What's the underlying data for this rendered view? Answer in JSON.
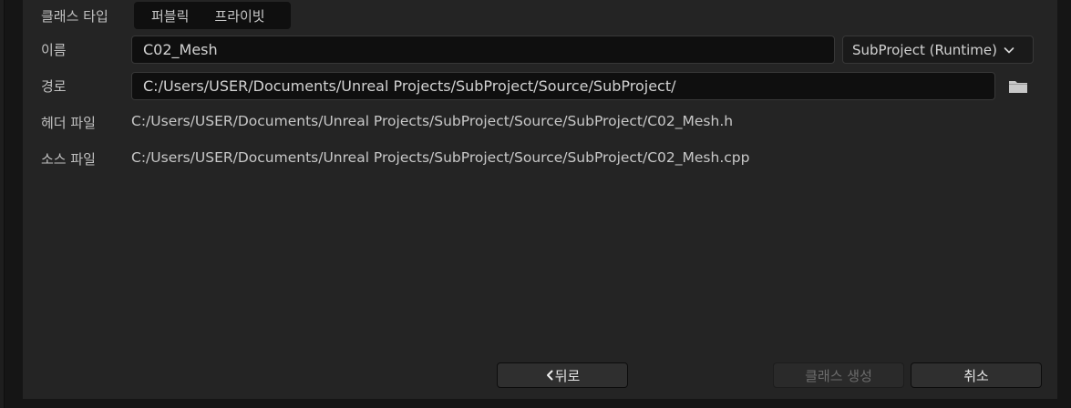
{
  "form": {
    "class_type_label": "클래스 타입",
    "class_type_options": [
      "퍼블릭",
      "프라이빗"
    ],
    "name_label": "이름",
    "name_value": "C02_Mesh",
    "module_dropdown": "SubProject (Runtime)",
    "path_label": "경로",
    "path_value": "C:/Users/USER/Documents/Unreal Projects/SubProject/Source/SubProject/",
    "header_file_label": "헤더 파일",
    "header_file_value": "C:/Users/USER/Documents/Unreal Projects/SubProject/Source/SubProject/C02_Mesh.h",
    "source_file_label": "소스 파일",
    "source_file_value": "C:/Users/USER/Documents/Unreal Projects/SubProject/Source/SubProject/C02_Mesh.cpp"
  },
  "buttons": {
    "back": "뒤로",
    "create_class": "클래스 생성",
    "cancel": "취소"
  },
  "icons": {
    "folder": "folder-icon",
    "chevron": "chevron-down-icon",
    "back_arrow": "chevron-left-icon"
  }
}
